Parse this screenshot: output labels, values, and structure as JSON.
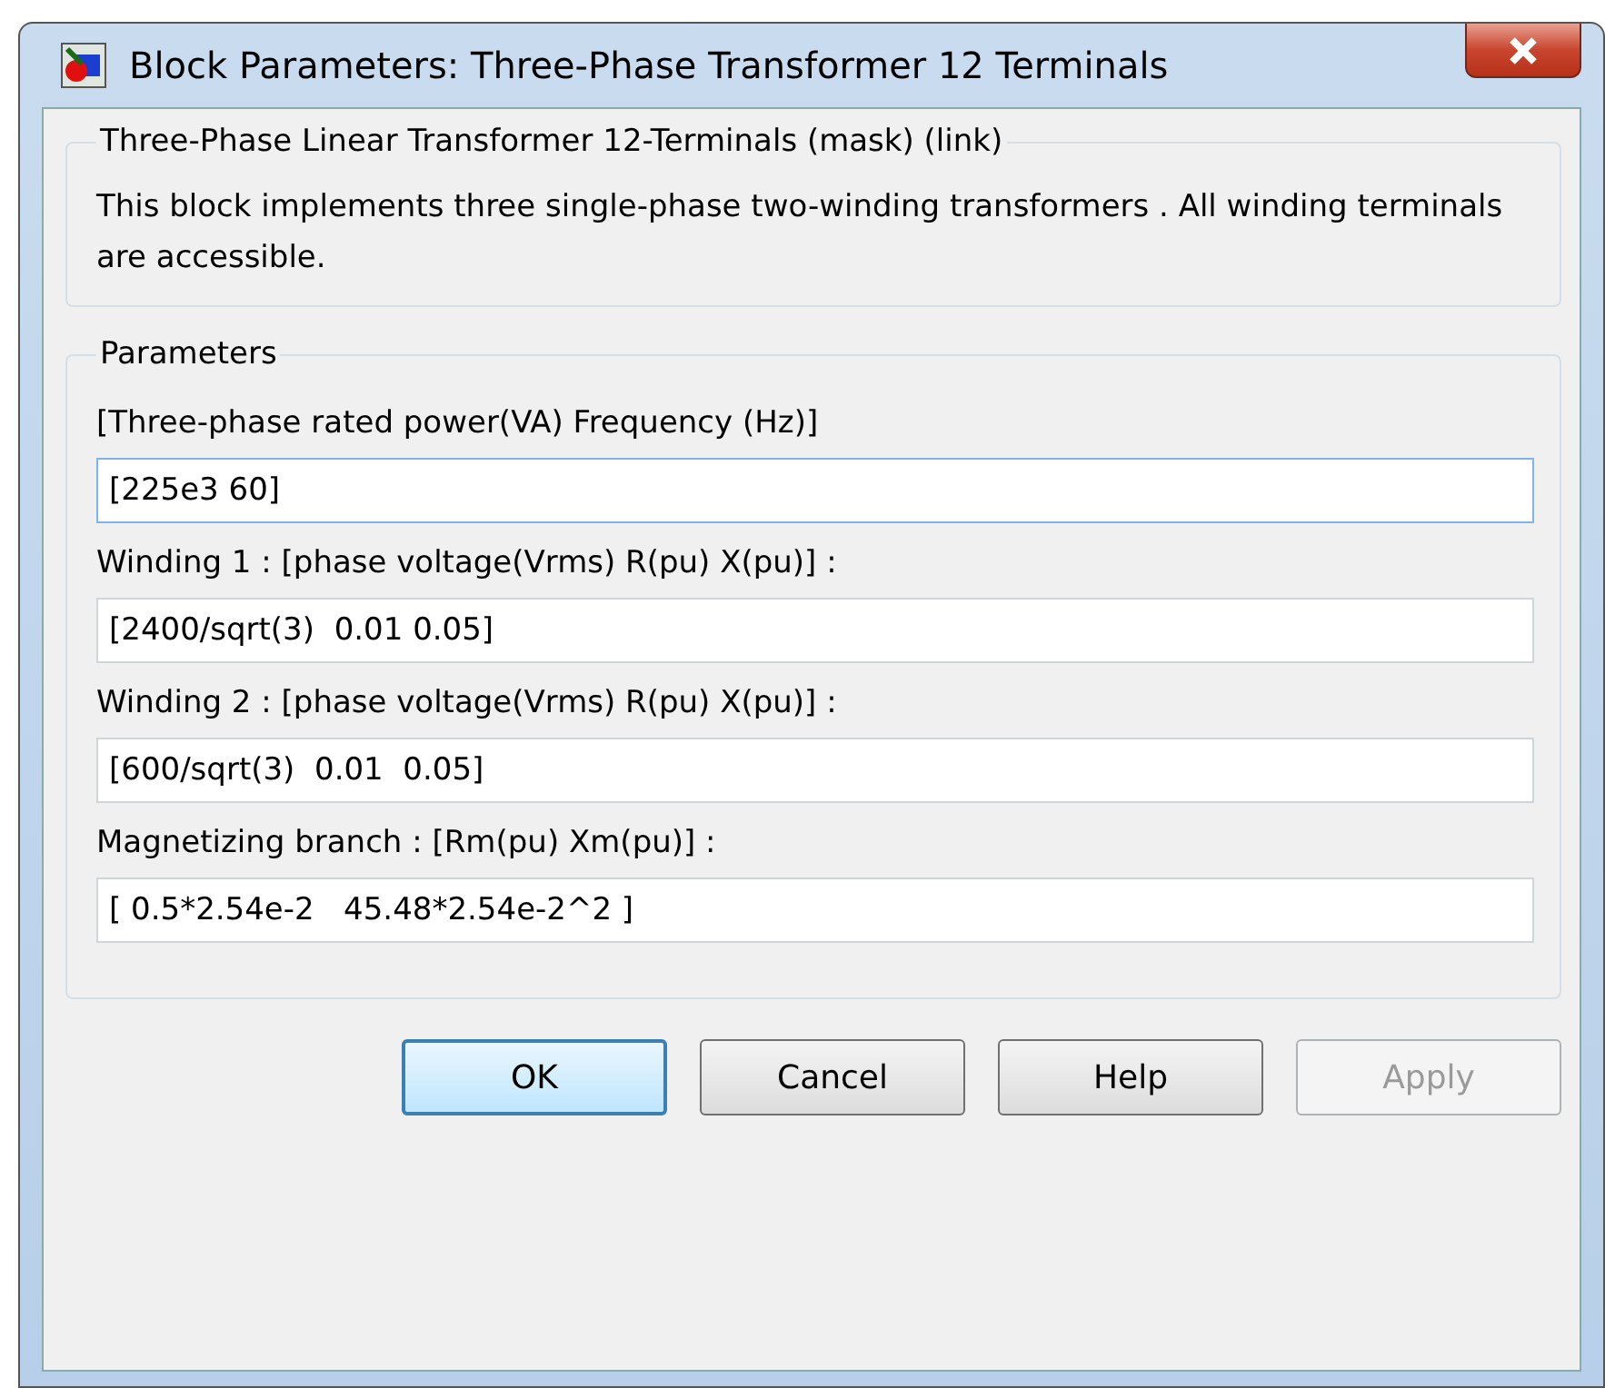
{
  "window": {
    "title": "Block Parameters: Three-Phase Transformer 12 Terminals"
  },
  "description": {
    "title": "Three-Phase Linear Transformer 12-Terminals (mask) (link)",
    "text": "This block implements three single-phase two-winding transformers . All winding terminals are accessible."
  },
  "parameters": {
    "title": "Parameters",
    "fields": [
      {
        "label": "[Three-phase rated power(VA)  Frequency (Hz)]",
        "value": "[225e3 60]",
        "focused": true
      },
      {
        "label": "Winding 1 : [phase voltage(Vrms)  R(pu)  X(pu)] :",
        "value": "[2400/sqrt(3)  0.01 0.05]",
        "focused": false
      },
      {
        "label": "Winding 2 : [phase voltage(Vrms)  R(pu)  X(pu)] :",
        "value": "[600/sqrt(3)  0.01  0.05]",
        "focused": false
      },
      {
        "label": "Magnetizing branch : [Rm(pu)  Xm(pu)] :",
        "value": "[ 0.5*2.54e-2   45.48*2.54e-2^2 ]",
        "focused": false
      }
    ]
  },
  "buttons": [
    {
      "label": "OK",
      "default": true,
      "disabled": false
    },
    {
      "label": "Cancel",
      "default": false,
      "disabled": false
    },
    {
      "label": "Help",
      "default": false,
      "disabled": false
    },
    {
      "label": "Apply",
      "default": false,
      "disabled": true
    }
  ]
}
